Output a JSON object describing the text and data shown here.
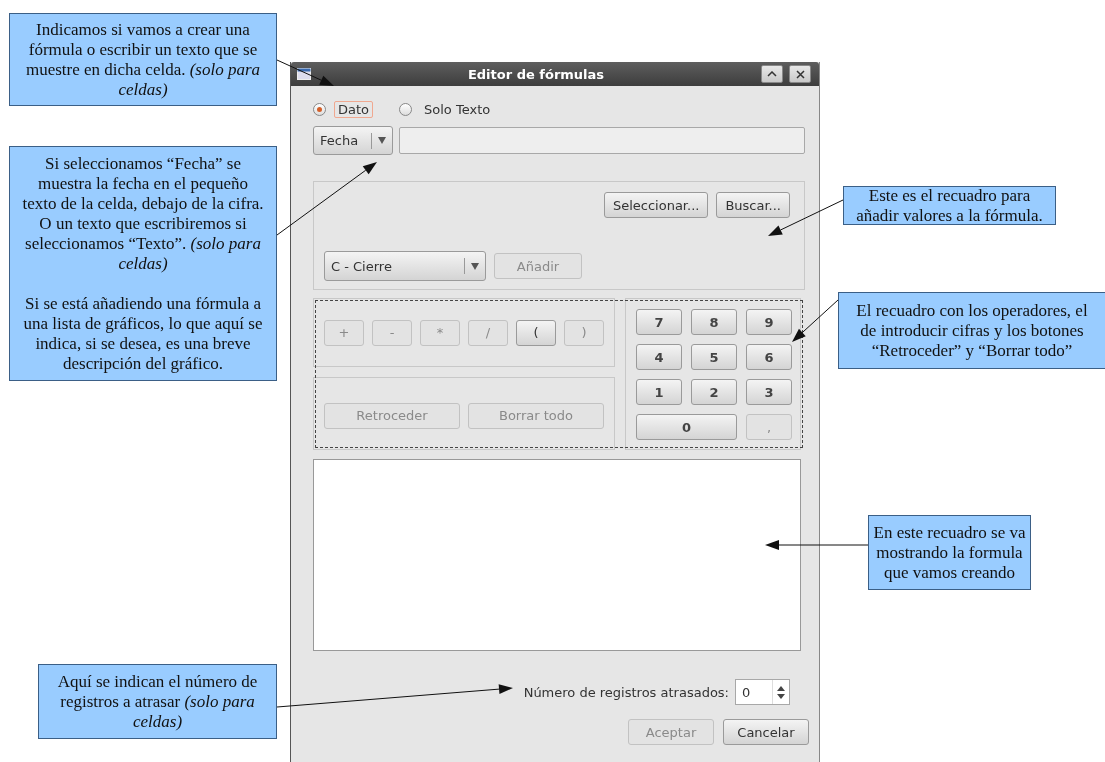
{
  "callouts": [
    {
      "paragraphs": [
        "Indicamos si vamos a crear una fórmula o escribir un texto que se muestre en dicha celda. *(solo para celdas)*"
      ]
    },
    {
      "paragraphs": [
        "Si seleccionamos “Fecha” se muestra la fecha en el pequeño texto de la celda, debajo de la cifra. O un texto que escribiremos si seleccionamos “Texto”. *(solo para celdas)*",
        "Si se está añadiendo una fórmula a una lista de gráficos, lo que aquí se indica, si se desea, es una breve descripción del gráfico."
      ]
    },
    {
      "paragraphs": [
        "Este es el recuadro para añadir valores a la fórmula."
      ]
    },
    {
      "paragraphs": [
        "El recuadro con los operadores, el de introducir cifras y los botones “Retroceder” y “Borrar todo”"
      ]
    },
    {
      "paragraphs": [
        "En este recuadro se va mostrando la formula que vamos creando"
      ]
    },
    {
      "paragraphs": [
        "Aquí se indican el número de registros a atrasar *(solo para celdas)*"
      ]
    }
  ],
  "dialog": {
    "title": "Editor de fórmulas",
    "mode_options": [
      {
        "label": "Dato",
        "selected": true
      },
      {
        "label": "Solo Texto",
        "selected": false
      }
    ],
    "type_combo": "Fecha",
    "values_box": {
      "buttons": [
        {
          "label": "Seleccionar...",
          "disabled": false
        },
        {
          "label": "Buscar...",
          "disabled": false
        }
      ],
      "combo": "C - Cierre",
      "add_button": {
        "label": "Añadir",
        "disabled": true
      }
    },
    "operators": [
      {
        "label": "+",
        "disabled": true
      },
      {
        "label": "-",
        "disabled": true
      },
      {
        "label": "*",
        "disabled": true
      },
      {
        "label": "/",
        "disabled": true
      },
      {
        "label": "(",
        "disabled": false
      },
      {
        "label": ")",
        "disabled": true
      }
    ],
    "edit_buttons": [
      {
        "label": "Retroceder",
        "disabled": true
      },
      {
        "label": "Borrar todo",
        "disabled": true
      }
    ],
    "keypad": [
      {
        "label": "7",
        "kind": "key",
        "disabled": false
      },
      {
        "label": "8",
        "kind": "key",
        "disabled": false
      },
      {
        "label": "9",
        "kind": "key",
        "disabled": false
      },
      {
        "label": "4",
        "kind": "key",
        "disabled": false
      },
      {
        "label": "5",
        "kind": "key",
        "disabled": false
      },
      {
        "label": "6",
        "kind": "key",
        "disabled": false
      },
      {
        "label": "1",
        "kind": "key",
        "disabled": false
      },
      {
        "label": "2",
        "kind": "key",
        "disabled": false
      },
      {
        "label": "3",
        "kind": "key",
        "disabled": false
      },
      {
        "label": "0",
        "kind": "wide",
        "disabled": false
      },
      {
        "label": ",",
        "kind": "key",
        "disabled": true
      }
    ],
    "spinner": {
      "label": "Número de registros atrasados:",
      "value": "0"
    },
    "footer_buttons": [
      {
        "label": "Aceptar",
        "disabled": true
      },
      {
        "label": "Cancelar",
        "disabled": false
      }
    ]
  }
}
